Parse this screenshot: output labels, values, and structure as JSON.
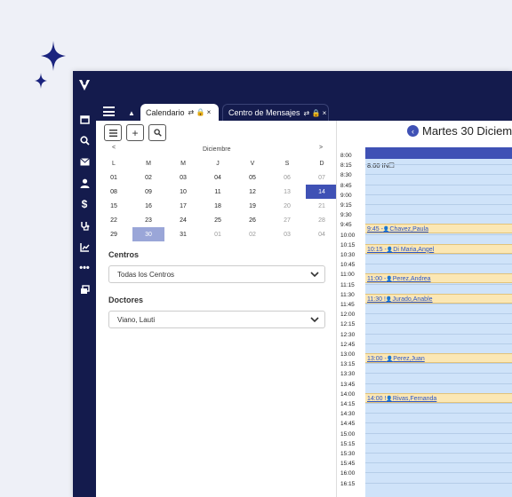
{
  "tabs": [
    {
      "label": "Calendario",
      "icons": "⇄ 🔒 ×"
    },
    {
      "label": "Centro de Mensajes",
      "icons": "⇄ 🔒 ×"
    }
  ],
  "calendar": {
    "prev": "<",
    "month": "Diciembre",
    "next": ">",
    "weekdays": [
      "L",
      "M",
      "M",
      "J",
      "V",
      "S",
      "D"
    ],
    "weeks": [
      [
        "01",
        "02",
        "03",
        "04",
        "05",
        "06",
        "07"
      ],
      [
        "08",
        "09",
        "10",
        "11",
        "12",
        "13",
        "14"
      ],
      [
        "15",
        "16",
        "17",
        "18",
        "19",
        "20",
        "21"
      ],
      [
        "22",
        "23",
        "24",
        "25",
        "26",
        "27",
        "28"
      ],
      [
        "29",
        "30",
        "31",
        "01",
        "02",
        "03",
        "04"
      ]
    ]
  },
  "filters": {
    "centros_label": "Centros",
    "centros_value": "Todas los Centros",
    "doctores_label": "Doctores",
    "doctores_value": "Viano, Lauti"
  },
  "day": {
    "title": "Martes 30 Diciem",
    "first_event": "8:00 IN☐",
    "times": [
      "8:00",
      "8:15",
      "8:30",
      "8:45",
      "9:00",
      "9:15",
      "9:30",
      "9:45",
      "10:00",
      "10:15",
      "10:30",
      "10:45",
      "11:00",
      "11:15",
      "11:30",
      "11:45",
      "12:00",
      "12:15",
      "12:30",
      "12:45",
      "13:00",
      "13:15",
      "13:30",
      "13:45",
      "14:00",
      "14:15",
      "14:30",
      "14:45",
      "15:00",
      "15:15",
      "15:30",
      "15:45",
      "16:00",
      "16:15"
    ],
    "appointments": [
      {
        "time": "9:45",
        "label": "Chavez,Paula",
        "sep": " -"
      },
      {
        "time": "10:15",
        "label": "Di Maria,Angel",
        "sep": " -"
      },
      {
        "time": "11:00",
        "label": "Perez,Andrea",
        "sep": " -"
      },
      {
        "time": "11:30",
        "label": "Jurado,Anable",
        "sep": " !"
      },
      {
        "time": "13:00",
        "label": "Perez,Juan",
        "sep": " -"
      },
      {
        "time": "14:00",
        "label": "Rivas,Fernanda",
        "sep": " !"
      }
    ]
  },
  "colors": {
    "navy": "#141b4d",
    "accent": "#3f51b5",
    "slot": "#cfe3f9",
    "appt": "#fbe7b4"
  }
}
